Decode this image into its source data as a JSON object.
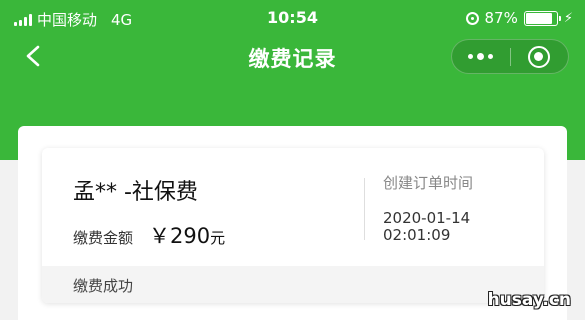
{
  "status_bar": {
    "carrier": "中国移动",
    "network": "4G",
    "time": "10:54",
    "battery": "87%",
    "battery_level": 0.87,
    "icons": [
      "signal-icon",
      "rotation-lock-icon",
      "battery-icon",
      "charging-icon"
    ]
  },
  "nav": {
    "title": "缴费记录",
    "back_icon": "chevron-left-icon",
    "more_icon": "more-dots-icon",
    "close_icon": "target-circle-icon"
  },
  "record": {
    "title": "孟**  -社保费",
    "amount_label": "缴费金额",
    "amount_value": "￥290",
    "amount_unit": "元",
    "time_label": "创建订单时间",
    "time_date": "2020-01-14",
    "time_clock": "02:01:09",
    "status": "缴费成功"
  },
  "watermark": "husay.cn",
  "colors": {
    "brand_green": "#3ab73a",
    "card_bg": "#ffffff",
    "footer_bg": "#f4f4f4"
  }
}
